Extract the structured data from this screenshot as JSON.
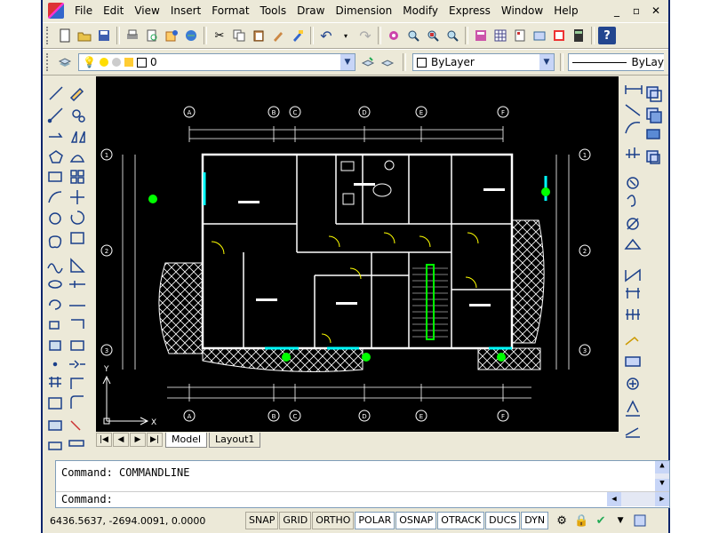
{
  "menu": [
    "File",
    "Edit",
    "View",
    "Insert",
    "Format",
    "Tools",
    "Draw",
    "Dimension",
    "Modify",
    "Express",
    "Window",
    "Help"
  ],
  "window_controls": [
    "_",
    "▫",
    "✕"
  ],
  "layer": {
    "name": "0"
  },
  "color": {
    "value": "ByLayer"
  },
  "linetype": {
    "value": "ByLay"
  },
  "tabs": [
    "Model",
    "Layout1"
  ],
  "command": {
    "history": "Command:  COMMANDLINE",
    "prompt": "Command:"
  },
  "status": {
    "coords": "6436.5637, -2694.0091, 0.0000",
    "buttons": [
      "SNAP",
      "GRID",
      "ORTHO",
      "POLAR",
      "OSNAP",
      "OTRACK",
      "DUCS",
      "DYN"
    ],
    "active": [
      "POLAR",
      "OSNAP",
      "OTRACK",
      "DUCS",
      "DYN"
    ]
  },
  "ucs": {
    "x": "X",
    "y": "Y"
  },
  "grid": {
    "top_labels": [
      "A",
      "B",
      "C",
      "D",
      "E",
      "F"
    ],
    "side_labels": [
      "1",
      "2",
      "3"
    ]
  },
  "colors": {
    "canvas": "#000000",
    "lines": "#ffffff",
    "hatch": "#ffffff",
    "accent": "#00ffff",
    "green": "#00ff00",
    "yellow": "#ffff00"
  }
}
